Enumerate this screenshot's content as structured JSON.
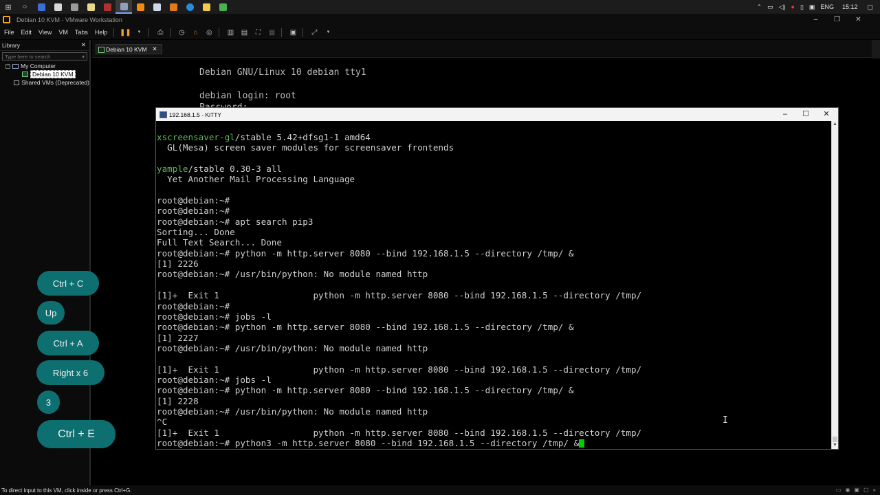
{
  "taskbar": {
    "tray": {
      "language": "ENG",
      "time": "15:12"
    }
  },
  "vmware": {
    "window_title": "Debian 10 KVM - VMware Workstation",
    "menu": [
      "File",
      "Edit",
      "View",
      "VM",
      "Tabs",
      "Help"
    ],
    "library": {
      "title": "Library",
      "search_placeholder": "Type here to search",
      "tree": {
        "root": "My Computer",
        "vm": "Debian 10 KVM",
        "shared": "Shared VMs (Deprecated)"
      }
    },
    "tab_label": "Debian 10 KVM",
    "console": {
      "line1": "Debian GNU/Linux 10 debian tty1",
      "line2": "debian login: root",
      "line3": "Password:"
    },
    "status_text": "To direct input to this VM, click inside or press Ctrl+G."
  },
  "kitty": {
    "title": "192.168.1.5 - KiTTY",
    "lines": [
      {
        "pkg": "xscreensaver-gl",
        "rest": "/stable 5.42+dfsg1-1 amd64"
      },
      {
        "text": "  GL(Mesa) screen saver modules for screensaver frontends"
      },
      {
        "text": ""
      },
      {
        "pkg": "yample",
        "rest": "/stable 0.30-3 all"
      },
      {
        "text": "  Yet Another Mail Processing Language"
      },
      {
        "text": ""
      },
      {
        "text": "root@debian:~#"
      },
      {
        "text": "root@debian:~#"
      },
      {
        "text": "root@debian:~# apt search pip3"
      },
      {
        "text": "Sorting... Done"
      },
      {
        "text": "Full Text Search... Done"
      },
      {
        "text": "root@debian:~# python -m http.server 8080 --bind 192.168.1.5 --directory /tmp/ &"
      },
      {
        "text": "[1] 2226"
      },
      {
        "text": "root@debian:~# /usr/bin/python: No module named http"
      },
      {
        "text": ""
      },
      {
        "text": "[1]+  Exit 1                  python -m http.server 8080 --bind 192.168.1.5 --directory /tmp/"
      },
      {
        "text": "root@debian:~#"
      },
      {
        "text": "root@debian:~# jobs -l"
      },
      {
        "text": "root@debian:~# python -m http.server 8080 --bind 192.168.1.5 --directory /tmp/ &"
      },
      {
        "text": "[1] 2227"
      },
      {
        "text": "root@debian:~# /usr/bin/python: No module named http"
      },
      {
        "text": ""
      },
      {
        "text": "[1]+  Exit 1                  python -m http.server 8080 --bind 192.168.1.5 --directory /tmp/"
      },
      {
        "text": "root@debian:~# jobs -l"
      },
      {
        "text": "root@debian:~# python -m http.server 8080 --bind 192.168.1.5 --directory /tmp/ &"
      },
      {
        "text": "[1] 2228"
      },
      {
        "text": "root@debian:~# /usr/bin/python: No module named http"
      },
      {
        "text": "^C"
      },
      {
        "text": "[1]+  Exit 1                  python -m http.server 8080 --bind 192.168.1.5 --directory /tmp/"
      }
    ],
    "current_line": "root@debian:~# python3 -m http.server 8080 --bind 192.168.1.5 --directory /tmp/ &"
  },
  "keystrokes": [
    "Ctrl + C",
    "Up",
    "Ctrl + A",
    "Right x 6",
    "3",
    "Ctrl + E"
  ],
  "colors": {
    "pill": "#0e6f71",
    "package_green": "#5cb85c",
    "cursor_green": "#00d000"
  }
}
